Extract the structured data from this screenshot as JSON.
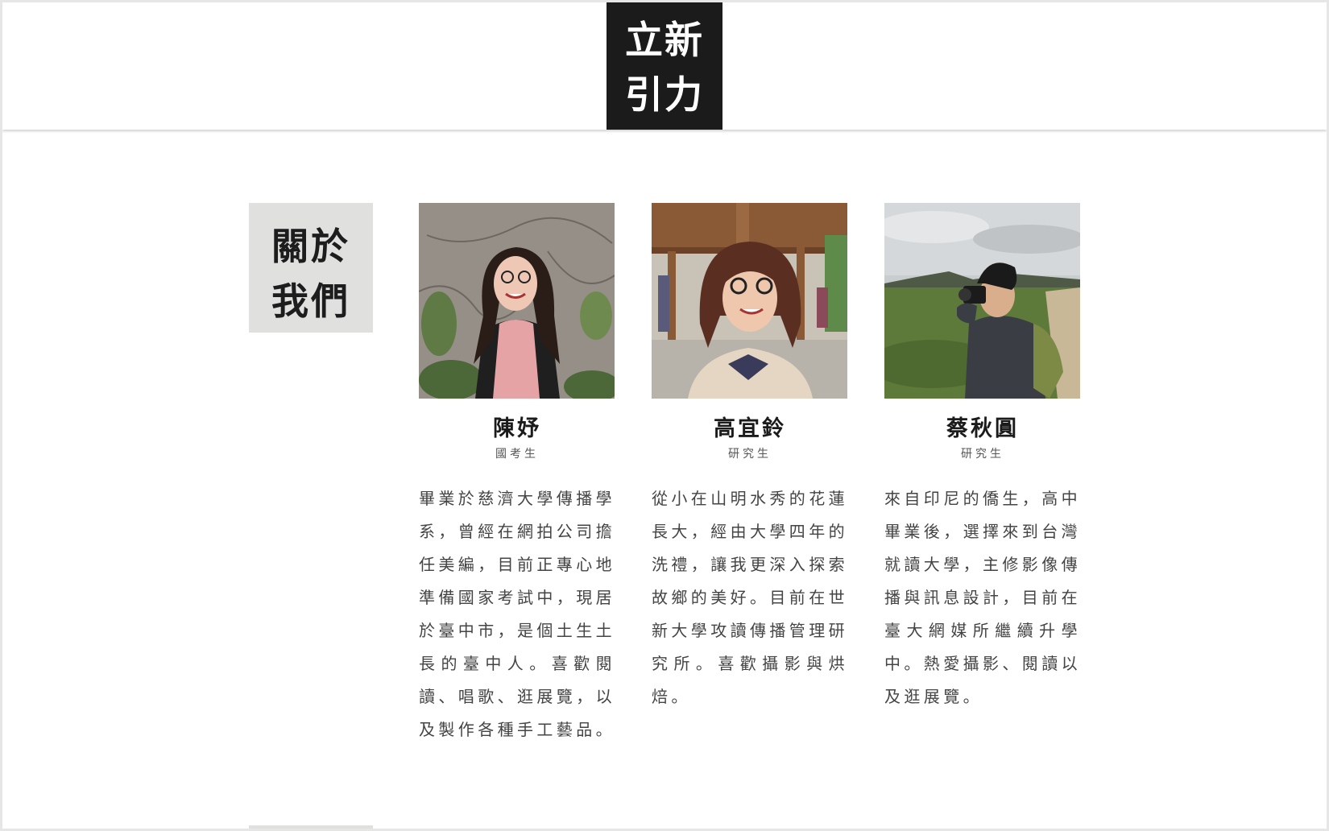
{
  "header": {
    "logo_line1": "立新",
    "logo_line2": "引力"
  },
  "about": {
    "title_line1": "關於",
    "title_line2": "我們"
  },
  "members": [
    {
      "name": "陳妤",
      "role": "國考生",
      "bio": "畢業於慈濟大學傳播學系，曾經在網拍公司擔任美編，目前正專心地準備國家考試中，現居於臺中市，是個土生土長的臺中人。喜歡閱讀、唱歌、逛展覽，以及製作各種手工藝品。"
    },
    {
      "name": "高宜鈴",
      "role": "研究生",
      "bio": "從小在山明水秀的花蓮長大，經由大學四年的洗禮，讓我更深入探索故鄉的美好。目前在世新大學攻讀傳播管理研究所。喜歡攝影與烘焙。"
    },
    {
      "name": "蔡秋圓",
      "role": "研究生",
      "bio": "來自印尼的僑生，高中畢業後，選擇來到台灣就讀大學，主修影像傳播與訊息設計，目前在臺大網媒所繼續升學中。熱愛攝影、閱讀以及逛展覽。"
    }
  ],
  "colors": {
    "logo_bg": "#1b1b1b",
    "badge_bg": "#e0e0de",
    "text": "#444444"
  }
}
